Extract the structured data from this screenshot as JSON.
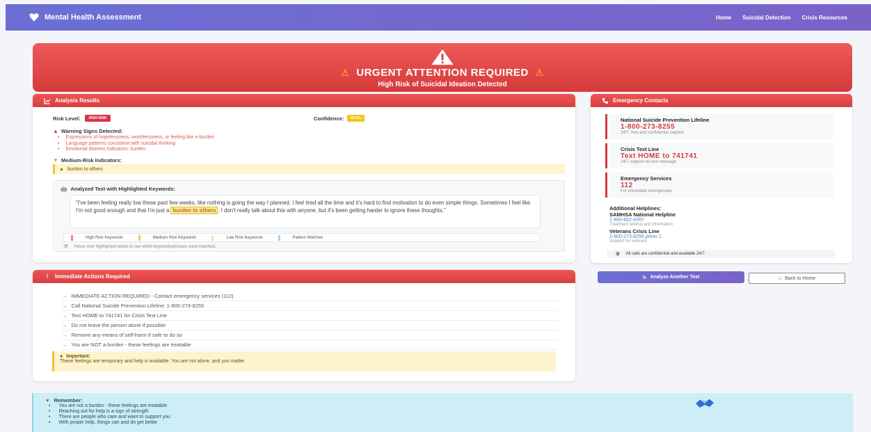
{
  "navbar": {
    "brand": "Mental Health Assessment",
    "links": [
      "Home",
      "Suicidal Detection",
      "Crisis Resources"
    ]
  },
  "alert": {
    "title": "URGENT ATTENTION REQUIRED",
    "subtitle": "High Risk of Suicidal Ideation Detected"
  },
  "analysis": {
    "header": "Analysis Results",
    "risk_label": "Risk Level:",
    "risk_value": "HIGH RISK",
    "confidence_label": "Confidence:",
    "confidence_value": "85.0%",
    "warning_title": "Warning Signs Detected:",
    "warning_items": [
      "Expressions of hopelessness, worthlessness, or feeling like a burden",
      "Language patterns consistent with suicidal thinking",
      "Emotional distress indicators: burden"
    ],
    "medium_title": "Medium-Risk Indicators:",
    "medium_items": [
      "burden to others"
    ],
    "text_title": "Analyzed Text with Highlighted Keywords:",
    "quote_before": "\"I've been feeling really low these past few weeks, like nothing is going the way I planned. I feel tired all the time and it's hard to find motivation to do even simple things. Sometimes I feel like I'm not good enough and that I'm just a ",
    "quote_highlight": "burden to others",
    "quote_after": ". I don't really talk about this with anyone, but it's been getting harder to ignore these thoughts.\"",
    "legend": [
      "High Risk Keywords",
      "Medium Risk Keywords",
      "Low Risk Keywords",
      "Pattern Matches"
    ],
    "hint": "Hover over highlighted words to see which keywords/phrases were matched."
  },
  "contacts": {
    "header": "Emergency Contacts",
    "items": [
      {
        "name": "National Suicide Prevention Lifeline",
        "value": "1-800-273-8255",
        "desc": "24/7, free and confidential support"
      },
      {
        "name": "Crisis Text Line",
        "value": "Text HOME to 741741",
        "desc": "24/7 support via text message"
      },
      {
        "name": "Emergency Services",
        "value": "112",
        "desc": "For immediate emergencies"
      }
    ],
    "additional_title": "Additional Helplines:",
    "additional": [
      {
        "name": "SAMHSA National Helpline",
        "number": "1-800-662-4357",
        "desc": "Treatment referral and information"
      },
      {
        "name": "Veterans Crisis Line",
        "number": "1-800-273-8255 press 1",
        "desc": "Support for veterans"
      }
    ],
    "confidential": "All calls are confidential and available 24/7."
  },
  "buttons": {
    "analyze": "Analyze Another Text",
    "back": "Back to Home"
  },
  "actions": {
    "header": "Immediate Actions Required",
    "items": [
      "IMMEDIATE ACTION REQUIRED - Contact emergency services (112)",
      "Call National Suicide Prevention Lifeline: 1-800-273-8255",
      "Text HOME to 741741 for Crisis Text Line",
      "Do not leave the person alone if possible",
      "Remove any means of self-harm if safe to do so",
      "You are NOT a burden - these feelings are treatable"
    ],
    "important_title": "Important:",
    "important_text": "These feelings are temporary and help is available. You are not alone, and you matter."
  },
  "remember": {
    "title": "Remember:",
    "items": [
      "You are not a burden - these feelings are treatable",
      "Reaching out for help is a sign of strength",
      "There are people who care and want to support you",
      "With proper help, things can and do get better"
    ]
  },
  "colors": {
    "nav": "#6b6fd4",
    "danger": "#d63a3a",
    "warning": "#f5c518",
    "info_bg": "#cdeef7",
    "link": "#4a7bd8"
  },
  "icons": [
    "heart-icon",
    "warning-triangle-icon",
    "chart-icon",
    "phone-icon",
    "robot-icon",
    "eye-icon",
    "exclamation-icon",
    "arrow-right-icon",
    "lightbulb-icon",
    "redo-icon",
    "home-icon",
    "handshake-icon"
  ]
}
